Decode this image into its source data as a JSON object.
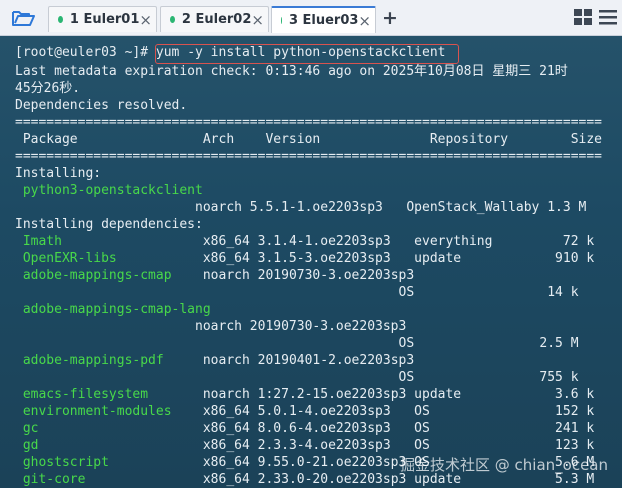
{
  "tabs": [
    {
      "label": "1 Euler01",
      "dot_color": "#2bb673",
      "active": false
    },
    {
      "label": "2 Euler02",
      "dot_color": "#2bb673",
      "active": false
    },
    {
      "label": "3 Eluer03",
      "dot_color": "#2bb673",
      "active": true
    }
  ],
  "tab_close_glyph": "×",
  "add_tab_glyph": "+",
  "terminal": {
    "prompt": "[root@euler03 ~]#",
    "command": "yum -y install python-openstackclient",
    "meta_line1": "Last metadata expiration check: 0:13:46 ago on 2025年10月08日 星期三 21时",
    "meta_line2": "45分26秒.",
    "deps_resolved": "Dependencies resolved.",
    "separator": "===========================================================================",
    "header": " Package                Arch    Version              Repository        Size",
    "installing": "Installing:",
    "installing_deps": "Installing dependencies:",
    "packages": [
      {
        "name": " python3-openstackclient",
        "rest": ""
      },
      {
        "name": "",
        "rest": "                       noarch 5.5.1-1.oe2203sp3   OpenStack_Wallaby 1.3 M"
      },
      {
        "name": " Imath",
        "rest": "                  x86_64 3.1.4-1.oe2203sp3   everything         72 k"
      },
      {
        "name": " OpenEXR-libs",
        "rest": "           x86_64 3.1.5-3.oe2203sp3   update            910 k"
      },
      {
        "name": " adobe-mappings-cmap",
        "rest": "    noarch 20190730-3.oe2203sp3"
      },
      {
        "name": "",
        "rest": "                                                 OS                 14 k"
      },
      {
        "name": " adobe-mappings-cmap-lang",
        "rest": ""
      },
      {
        "name": "",
        "rest": "                       noarch 20190730-3.oe2203sp3"
      },
      {
        "name": "",
        "rest": "                                                 OS                2.5 M"
      },
      {
        "name": " adobe-mappings-pdf",
        "rest": "     noarch 20190401-2.oe2203sp3"
      },
      {
        "name": "",
        "rest": "                                                 OS                755 k"
      },
      {
        "name": " emacs-filesystem",
        "rest": "       noarch 1:27.2-15.oe2203sp3 update            3.6 k"
      },
      {
        "name": " environment-modules",
        "rest": "    x86_64 5.0.1-4.oe2203sp3   OS                152 k"
      },
      {
        "name": " gc",
        "rest": "                     x86_64 8.0.6-4.oe2203sp3   OS                241 k"
      },
      {
        "name": " gd",
        "rest": "                     x86_64 2.3.3-4.oe2203sp3   OS                123 k"
      },
      {
        "name": " ghostscript",
        "rest": "            x86_64 9.55.0-21.oe2203sp3 OS                5.6 M"
      },
      {
        "name": " git-core",
        "rest": "               x86_64 2.33.0-20.oe2203sp3 update            5.3 M"
      }
    ]
  },
  "watermark": "掘金技术社区 @ chian_ocean"
}
